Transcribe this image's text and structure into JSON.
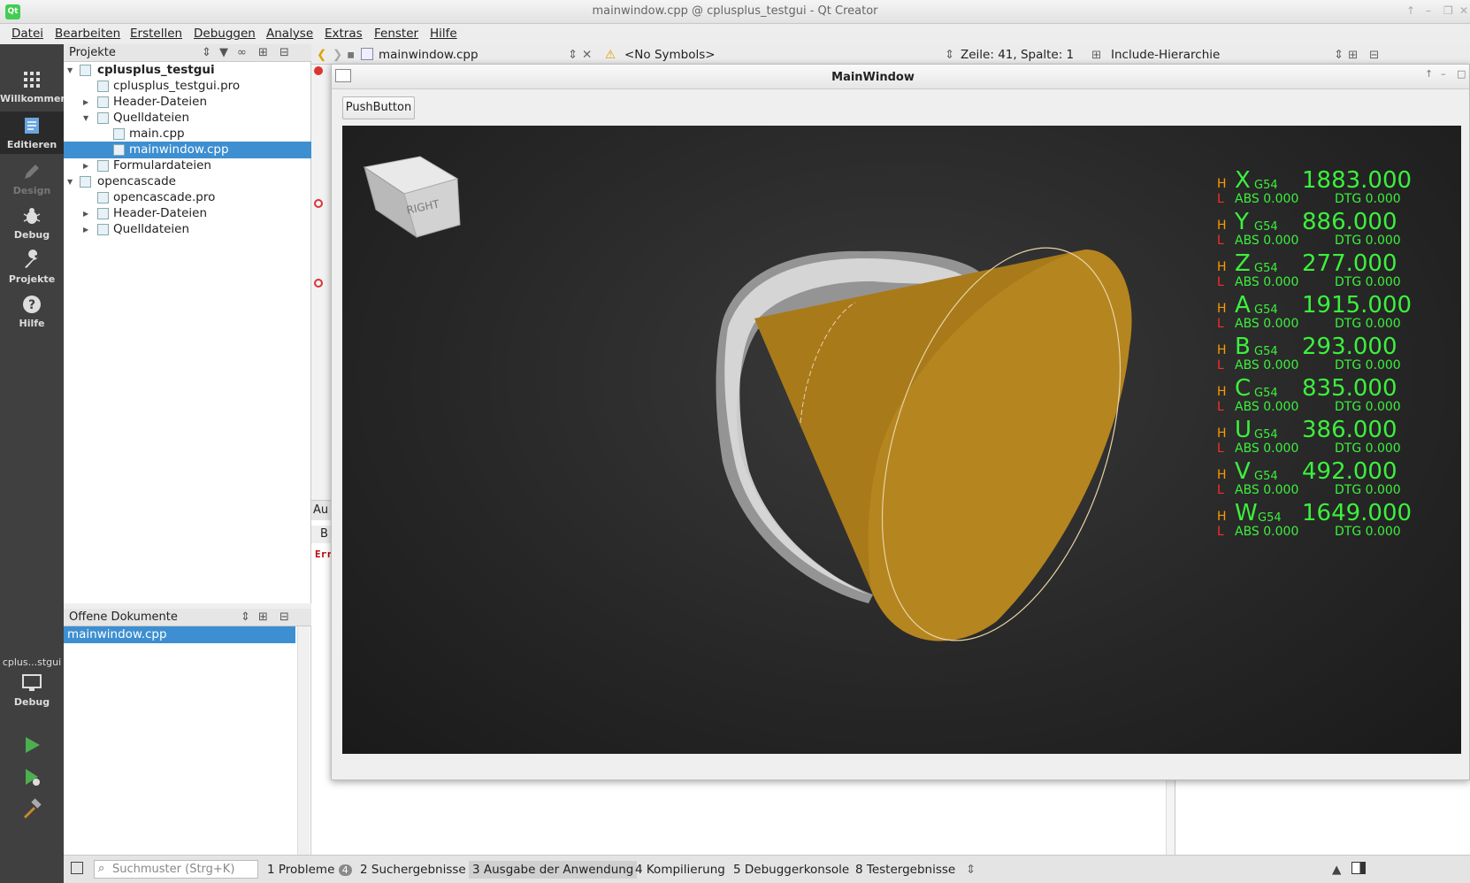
{
  "window": {
    "title": "mainwindow.cpp @ cplusplus_testgui - Qt Creator",
    "logo": "Qt"
  },
  "menu": [
    "Datei",
    "Bearbeiten",
    "Erstellen",
    "Debuggen",
    "Analyse",
    "Extras",
    "Fenster",
    "Hilfe"
  ],
  "modes": [
    {
      "label": "Willkommen",
      "icon": "grid-icon"
    },
    {
      "label": "Editieren",
      "icon": "edit-icon"
    },
    {
      "label": "Design",
      "icon": "pencil-icon"
    },
    {
      "label": "Debug",
      "icon": "bug-icon"
    },
    {
      "label": "Projekte",
      "icon": "wrench-icon"
    },
    {
      "label": "Hilfe",
      "icon": "help-icon"
    }
  ],
  "kit": {
    "name": "cplus...stgui",
    "mode": "Debug"
  },
  "projects_pane": {
    "title": "Projekte",
    "tree": [
      {
        "label": "cplusplus_testgui",
        "depth": 0,
        "expanded": true,
        "bold": true
      },
      {
        "label": "cplusplus_testgui.pro",
        "depth": 1
      },
      {
        "label": "Header-Dateien",
        "depth": 1,
        "collapsed": true
      },
      {
        "label": "Quelldateien",
        "depth": 1,
        "expanded": true
      },
      {
        "label": "main.cpp",
        "depth": 2
      },
      {
        "label": "mainwindow.cpp",
        "depth": 2,
        "selected": true
      },
      {
        "label": "Formulardateien",
        "depth": 1,
        "collapsed": true
      },
      {
        "label": "opencascade",
        "depth": 0,
        "expanded": true
      },
      {
        "label": "opencascade.pro",
        "depth": 1
      },
      {
        "label": "Header-Dateien",
        "depth": 1,
        "collapsed": true
      },
      {
        "label": "Quelldateien",
        "depth": 1,
        "collapsed": true
      }
    ]
  },
  "open_docs": {
    "title": "Offene Dokumente",
    "items": [
      "mainwindow.cpp"
    ]
  },
  "editor_toolbar": {
    "file": "mainwindow.cpp",
    "symbols": "<No Symbols>",
    "position": "Zeile: 41, Spalte: 1",
    "include": "Include-Hierarchie"
  },
  "output_fragments": {
    "tab": "Au",
    "sub": "B",
    "err": "Err"
  },
  "mainwindow": {
    "title": "MainWindow",
    "button": "PushButton",
    "viewcube": "RIGHT"
  },
  "dro": [
    {
      "axis": "X",
      "value": "1883.000"
    },
    {
      "axis": "Y",
      "value": "886.000"
    },
    {
      "axis": "Z",
      "value": "277.000"
    },
    {
      "axis": "A",
      "value": "1915.000"
    },
    {
      "axis": "B",
      "value": "293.000"
    },
    {
      "axis": "C",
      "value": "835.000"
    },
    {
      "axis": "U",
      "value": "386.000"
    },
    {
      "axis": "V",
      "value": "492.000"
    },
    {
      "axis": "W",
      "value": "1649.000"
    }
  ],
  "dro_labels": {
    "h": "H",
    "l": "L",
    "g": "G54",
    "abs": "ABS  0.000",
    "dtg": "DTG 0.000"
  },
  "status": {
    "search_placeholder": "Suchmuster (Strg+K)",
    "tabs": [
      "1  Probleme",
      "2  Suchergebnisse",
      "3  Ausgabe der Anwendung",
      "4  Kompilierung",
      "5  Debuggerkonsole",
      "8  Testergebnisse"
    ],
    "problems_count": "4"
  },
  "colors": {
    "accent": "#3d8fd1",
    "dro_green": "#3cf03c",
    "dro_h": "#ff9900",
    "dro_l": "#ff2a2a",
    "cone": "#b5851f"
  }
}
